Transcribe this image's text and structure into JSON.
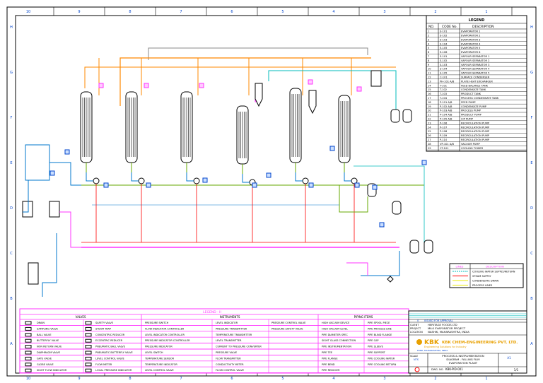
{
  "colors": {
    "border": "#000000",
    "utility": "#ff33ff",
    "steam": "#ff8800",
    "process": "#0077cc",
    "condensate": "#00bbbb",
    "vent": "#888888",
    "green": "#66aa00",
    "red": "#ff0000",
    "yellow": "#e8e800",
    "title_orange": "#e8a000"
  },
  "border_numbers_top": [
    "10",
    "9",
    "8",
    "7",
    "6",
    "5",
    "4",
    "3",
    "2",
    "1"
  ],
  "border_letters_side": [
    "H",
    "G",
    "F",
    "E",
    "D",
    "C",
    "B",
    "A"
  ],
  "legend_table": {
    "title": "LEGEND",
    "headers": [
      "NO.",
      "CODE No.",
      "DESCRIPTION"
    ],
    "rows": [
      [
        "1",
        "E-101",
        "EVAPORATOR 1"
      ],
      [
        "2",
        "E-102",
        "EVAPORATOR 2"
      ],
      [
        "3",
        "E-103",
        "EVAPORATOR 3"
      ],
      [
        "4",
        "E-104",
        "EVAPORATOR 4"
      ],
      [
        "5",
        "E-105",
        "EVAPORATOR 5"
      ],
      [
        "6",
        "E-106",
        "EVAPORATOR 6"
      ],
      [
        "7",
        "S-101",
        "VAPOUR SEPARATOR 1"
      ],
      [
        "8",
        "S-102",
        "VAPOUR SEPARATOR 2"
      ],
      [
        "9",
        "S-103",
        "VAPOUR SEPARATOR 3"
      ],
      [
        "10",
        "S-104",
        "VAPOUR SEPARATOR 4"
      ],
      [
        "11",
        "S-105",
        "VAPOUR SEPARATOR 5"
      ],
      [
        "12",
        "C-101",
        "SURFACE CONDENSER"
      ],
      [
        "13",
        "PH-101 A/B",
        "PLATE HEAT EXCHANGER"
      ],
      [
        "14",
        "T-101",
        "FEED BALANCE TANK"
      ],
      [
        "15",
        "T-102",
        "CONDENSATE TANK"
      ],
      [
        "16",
        "T-103",
        "PRODUCT TANK"
      ],
      [
        "17",
        "T-104",
        "PROCESS CONDENSATE TANK"
      ],
      [
        "18",
        "P-101 A/B",
        "FEED PUMP"
      ],
      [
        "19",
        "P-102 A/B",
        "CONDENSATE PUMP"
      ],
      [
        "20",
        "P-103 A/B",
        "PROCESS PUMP"
      ],
      [
        "21",
        "P-104 A/B",
        "PRODUCT PUMP"
      ],
      [
        "22",
        "P-105 A/B",
        "CIP PUMP"
      ],
      [
        "23",
        "P-106",
        "RECIRCULATION PUMP"
      ],
      [
        "24",
        "P-107",
        "RECIRCULATION PUMP"
      ],
      [
        "25",
        "P-108",
        "RECIRCULATION PUMP"
      ],
      [
        "26",
        "P-109",
        "RECIRCULATION PUMP"
      ],
      [
        "27",
        "P-110",
        "RECIRCULATION PUMP"
      ],
      [
        "28",
        "VP-101 A/B",
        "VACUUM PUMP"
      ],
      [
        "29",
        "CT-101",
        "COOLING TOWER"
      ]
    ]
  },
  "line_legend": {
    "headers": [
      "LINES",
      "DESCRIPTION"
    ],
    "rows": [
      {
        "label": "COOLING WATER SUPPLY/RETURN",
        "color": "#00bbbb",
        "dash": true
      },
      {
        "label": "STEAM SUPPLY",
        "color": "#ff0000",
        "dash": false
      },
      {
        "label": "CONDENSATE DRAIN",
        "color": "#e8e800",
        "dash": false
      },
      {
        "label": "PROCESS LINES",
        "color": "#e8e800",
        "dash": false
      }
    ]
  },
  "bottom_legend": {
    "title": "LEGEND - II",
    "sections": [
      "VALVES",
      "INSTRUMENTS",
      "PIPING ITEMS"
    ],
    "valves_a": [
      "DRAIN",
      "SAMPLING VALVE",
      "BALL VALVE",
      "BUTTERFLY VALVE",
      "NON RETURN VALVE",
      "DIAPHRAGM VALVE",
      "GATE VALVE",
      "GLOBE VALVE",
      "SIGHT FLOW INDICATOR"
    ],
    "valves_b": [
      "SAFETY VALVE",
      "STEAM TRAP",
      "CONCENTRIC REDUCER",
      "ECCENTRIC REDUCER",
      "PNEUMATIC BALL VALVE",
      "PNEUMATIC BUTTERFLY VALVE",
      "LEVEL CONTROL VALVE",
      "FLOW METER",
      "LOCAL PRESSURE INDICATOR"
    ],
    "instruments_a": [
      "PRESSURE SWITCH",
      "FLOW INDICATOR CONTROLLER",
      "LEVEL INDICATOR CONTROLLER",
      "PRESSURE INDICATOR CONTROLLER",
      "PRESSURE INDICATOR",
      "LEVEL SWITCH",
      "TEMPERATURE SENSOR",
      "TEMPERATURE INDICATOR",
      "LEVEL CONTROL VALVE"
    ],
    "instruments_b": [
      "LEVEL INDICATOR",
      "PRESSURE TRANSMITTER",
      "TEMPERATURE TRANSMITTER",
      "LEVEL TRANSMITTER",
      "CURRENT TO PRESSURE CONVERTER",
      "PRESSURE VALVE",
      "FLOW TRANSMITTER",
      "CONDUCTIVITY METER",
      "FLOW CONTROL VALVE"
    ],
    "instruments_c": [
      "PRESSURE CONTROL VALVE",
      "PRESSURE SAFETY VALVE"
    ],
    "piping_a": [
      "HIGH VACUUM DEVICE",
      "HIGH VACUUM LEVEL",
      "PIPE DIAMETER SPEC",
      "SIGHT GLASS CONNECTION",
      "PIPE INSTRUMENTATION",
      "PIPE TEE",
      "PIPE FLANGE",
      "PIPE BEND",
      "PIPE REDUCER"
    ],
    "piping_b": [
      "PIPE SPOOL PIECE",
      "PIPE PROCESS LINE",
      "PIPE BLIND FLANGE",
      "PIPE CAP",
      "PIPE SLEEVE",
      "PIPE SUPPORT",
      "PIPE COOLING WATER",
      "PIPE COOLING RETURN"
    ]
  },
  "title_block": {
    "rev": "0",
    "rev_desc": "ISSUED FOR APPROVAL",
    "client_label": "CLIENT",
    "client": "HERITAGE FOODS LTD",
    "project_label": "PROJECT",
    "project": "MILK EVAPORATOR PROJECT",
    "location_label": "LOCATION",
    "location": "NASHIK, MAHARASHTRA, INDIA",
    "logo": "KBK",
    "company": "KBK CHEM-ENGINEERING PVT. LTD.",
    "tagline": "Engineering Solutions for Industry",
    "address": "PUNE, MAHARASHTRA, INDIA",
    "drawing_title": [
      "PROCESS & INSTRUMENTATION",
      "DIAGRAM - FALLING FILM",
      "EVAPORATION PLANT"
    ],
    "dwg_no_label": "DWG. NO.",
    "dwg_no": "KBK-PID-001",
    "scale_label": "SCALE",
    "scale": "NTS",
    "sheet": "1/1",
    "size": "A1"
  }
}
